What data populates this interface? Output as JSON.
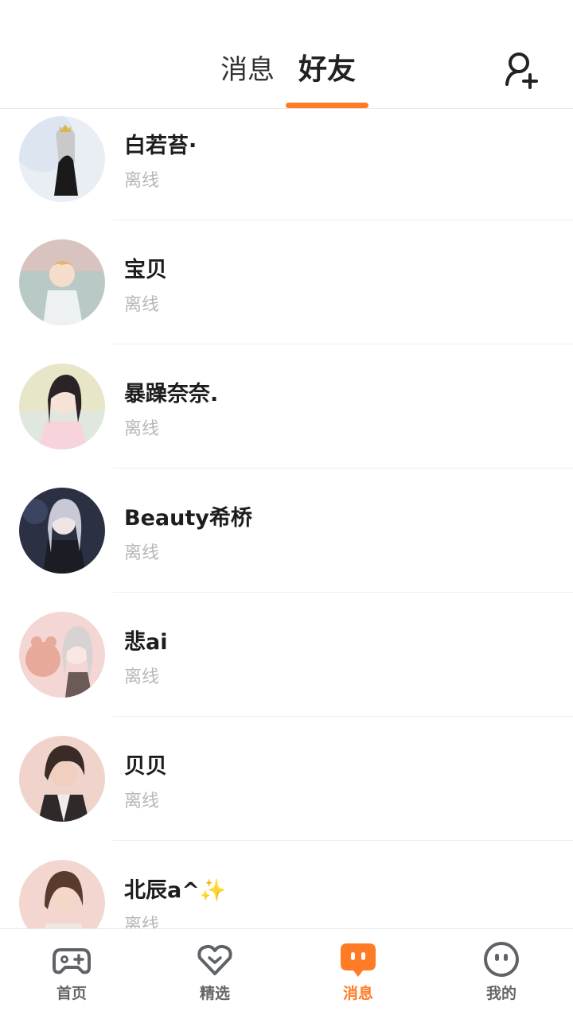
{
  "header": {
    "tabs": [
      {
        "label": "消息",
        "active": false
      },
      {
        "label": "好友",
        "active": true
      }
    ],
    "accent_color": "#ff7b26",
    "add_friend_icon": "add-user-icon"
  },
  "friends": [
    {
      "name": "白若苔·",
      "status": "离线"
    },
    {
      "name": "宝贝",
      "status": "离线"
    },
    {
      "name": "暴躁奈奈.",
      "status": "离线"
    },
    {
      "name": "Beauty希桥",
      "status": "离线"
    },
    {
      "name": "悲ai",
      "status": "离线"
    },
    {
      "name": "贝贝",
      "status": "离线"
    },
    {
      "name": "北辰a^✨",
      "status": "离线"
    }
  ],
  "tabbar": {
    "items": [
      {
        "label": "首页",
        "icon": "gamepad-icon",
        "active": false
      },
      {
        "label": "精选",
        "icon": "heart-icon",
        "active": false
      },
      {
        "label": "消息",
        "icon": "message-icon",
        "active": true
      },
      {
        "label": "我的",
        "icon": "face-icon",
        "active": false
      }
    ]
  }
}
